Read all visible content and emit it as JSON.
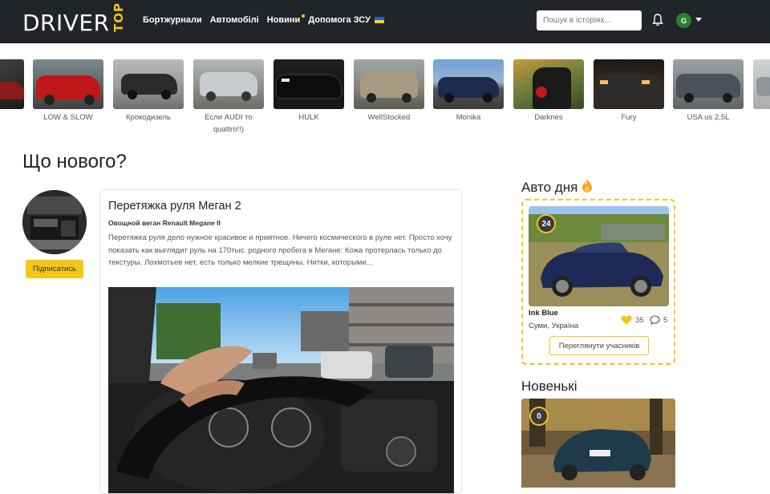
{
  "header": {
    "logo_main": "DRIVER",
    "logo_sub": "TOP",
    "nav": [
      {
        "label": "Бортжурнали"
      },
      {
        "label": "Автомобілі"
      },
      {
        "label": "Новини"
      },
      {
        "label": "Допомога ЗСУ"
      }
    ],
    "search_placeholder": "Пошук в історіях...",
    "avatar_letter": "G"
  },
  "car_strip": [
    {
      "label": "LOW & SLOW"
    },
    {
      "label": "Крокодизель"
    },
    {
      "label": "Если AUDI то quattro!!)"
    },
    {
      "label": "HULK"
    },
    {
      "label": "WellStocked"
    },
    {
      "label": "Monika"
    },
    {
      "label": "Darknes"
    },
    {
      "label": "Fury"
    },
    {
      "label": "USA us 2,5L"
    }
  ],
  "main": {
    "title": "Що нового?",
    "subscribe_label": "Підписатись",
    "post": {
      "title": "Перетяжка руля Меган 2",
      "author": "Овощной веган Renault Megane II",
      "text": "Перетяжка руля дело нужное красивое и приятное. Ничего космического в руле нет. Просто хочу показать как выглядит руль на 170тыс. родного пробега в Мегане:  Кожа протерлась только до текстуры. Лохмотьев нет, есть только мелкие трещины.  Нитки, которыми..."
    }
  },
  "sidebar": {
    "car_of_day_title": "Авто дня",
    "car_of_day": {
      "rank": "24",
      "name": "Ink Blue",
      "city": "Суми, Україна",
      "likes": "35",
      "comments": "5",
      "button_label": "Переглянути учасників"
    },
    "new_title": "Новенькі",
    "new_rank": "0"
  },
  "colors": {
    "accent": "#f5c518",
    "header_bg": "#212529"
  }
}
